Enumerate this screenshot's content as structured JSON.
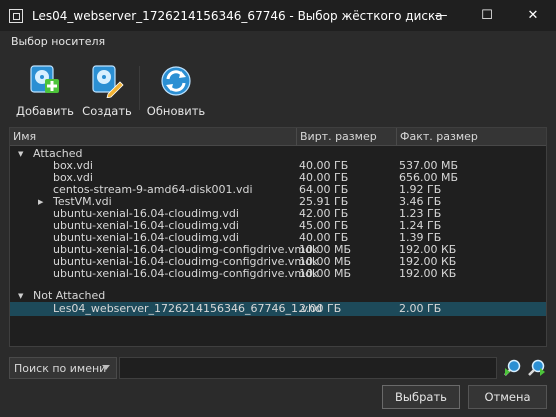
{
  "window": {
    "title": "Les04_webserver_1726214156346_67746 - Выбор жёсткого диска",
    "minimize_glyph": "—",
    "maximize_glyph": "☐",
    "close_glyph": "✕"
  },
  "group_label": "Выбор носителя",
  "toolbar": {
    "add_label": "Добавить",
    "create_label": "Создать",
    "refresh_label": "Обновить"
  },
  "table": {
    "headers": {
      "name": "Имя",
      "virtual_size": "Вирт. размер",
      "actual_size": "Факт. размер"
    },
    "attached_label": "Attached",
    "rows": [
      {
        "name": "box.vdi",
        "virtual_size": "40.00 ГБ",
        "actual_size": "537.00 МБ"
      },
      {
        "name": "box.vdi",
        "virtual_size": "40.00 ГБ",
        "actual_size": "656.00 МБ"
      },
      {
        "name": "centos-stream-9-amd64-disk001.vdi",
        "virtual_size": "64.00 ГБ",
        "actual_size": "1.92 ГБ"
      },
      {
        "name": "TestVM.vdi",
        "virtual_size": "25.91 ГБ",
        "actual_size": "3.46 ГБ"
      },
      {
        "name": "ubuntu-xenial-16.04-cloudimg.vdi",
        "virtual_size": "42.00 ГБ",
        "actual_size": "1.23 ГБ"
      },
      {
        "name": "ubuntu-xenial-16.04-cloudimg.vdi",
        "virtual_size": "45.00 ГБ",
        "actual_size": "1.24 ГБ"
      },
      {
        "name": "ubuntu-xenial-16.04-cloudimg.vdi",
        "virtual_size": "40.00 ГБ",
        "actual_size": "1.39 ГБ"
      },
      {
        "name": "ubuntu-xenial-16.04-cloudimg-configdrive.vmdk",
        "virtual_size": "10.00 МБ",
        "actual_size": "192.00 КБ"
      },
      {
        "name": "ubuntu-xenial-16.04-cloudimg-configdrive.vmdk",
        "virtual_size": "10.00 МБ",
        "actual_size": "192.00 КБ"
      },
      {
        "name": "ubuntu-xenial-16.04-cloudimg-configdrive.vmdk",
        "virtual_size": "10.00 МБ",
        "actual_size": "192.00 КБ"
      }
    ],
    "not_attached_label": "Not Attached",
    "not_attached_rows": [
      {
        "name": "Les04_webserver_1726214156346_67746_1.vhd",
        "virtual_size": "2.00 ГБ",
        "actual_size": "2.00 ГБ"
      }
    ]
  },
  "search": {
    "mode_value": "Поиск по имени",
    "value": ""
  },
  "buttons": {
    "select_label": "Выбрать",
    "cancel_label": "Отмена"
  },
  "colors": {
    "accent": "#1d4a5a",
    "icon_blue": "#3aa0e0",
    "icon_green": "#4cc43a"
  }
}
